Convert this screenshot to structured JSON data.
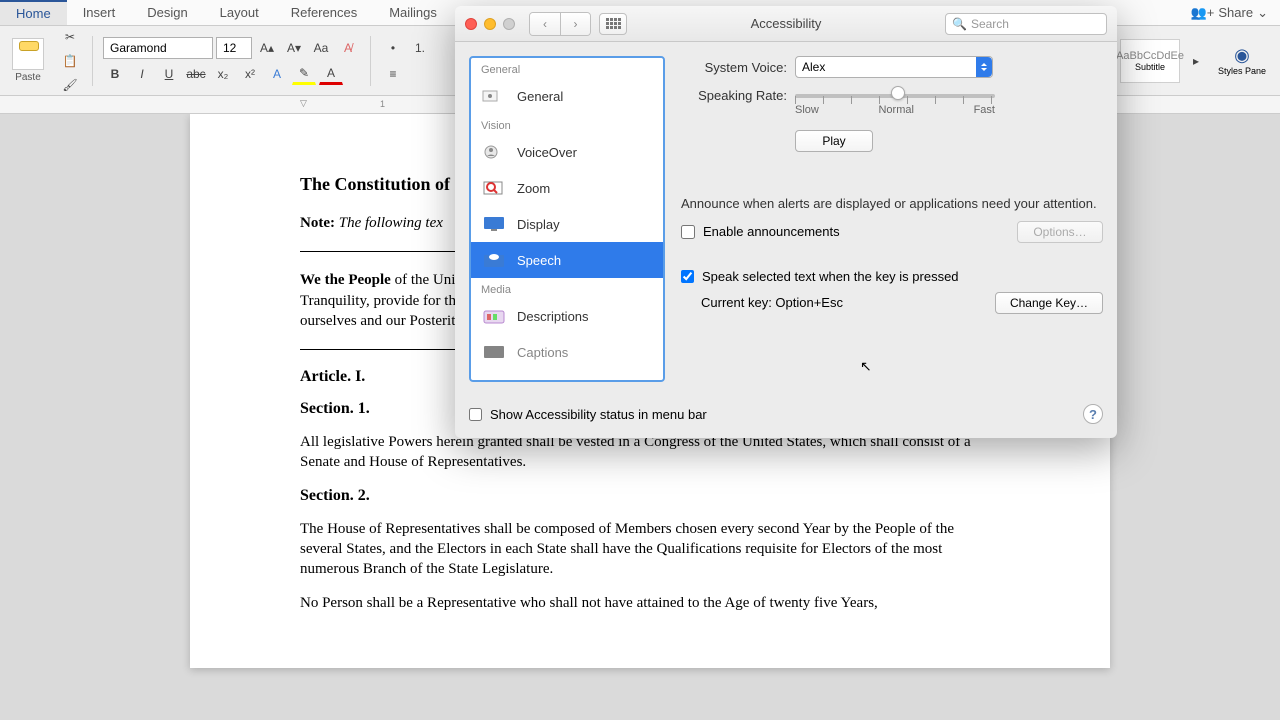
{
  "ribbon": {
    "tabs": [
      "Home",
      "Insert",
      "Design",
      "Layout",
      "References",
      "Mailings"
    ],
    "share": "Share"
  },
  "toolbar": {
    "paste": "Paste",
    "font": "Garamond",
    "size": "12"
  },
  "styles": {
    "preview_text": "AaBbCcDdEe",
    "subtitle": "Subtitle",
    "pane": "Styles Pane"
  },
  "document": {
    "title": "The Constitution of",
    "note_label": "Note:",
    "note_text": " The following tex",
    "preamble": "We the People of the United States, in Order to form a more perfect Union, establish Justice, insure domestic Tranquility, provide for the common defence, promote the general Welfare, and secure the Blessings of Liberty to ourselves and our Posterity, do ordain and establish this Constitution for the United States of America.",
    "article1": "Article. I.",
    "section1": "Section. 1.",
    "sec1_body": "All legislative Powers herein granted shall be vested in a Congress of the United States, which shall consist of a Senate and House of Representatives.",
    "section2": "Section. 2.",
    "sec2_body1": "The House of Representatives shall be composed of Members chosen every second Year by the People of the several States, and the Electors in each State shall have the Qualifications requisite for Electors of the most numerous Branch of the State Legislature.",
    "sec2_body2": "No Person shall be a Representative who shall not have attained to the Age of twenty five Years,"
  },
  "pref": {
    "title": "Accessibility",
    "search_placeholder": "Search",
    "sections": {
      "general": "General",
      "vision": "Vision",
      "media": "Media"
    },
    "items": {
      "general": "General",
      "voiceover": "VoiceOver",
      "zoom": "Zoom",
      "display": "Display",
      "speech": "Speech",
      "descriptions": "Descriptions",
      "captions": "Captions"
    },
    "detail": {
      "system_voice_label": "System Voice:",
      "system_voice_value": "Alex",
      "rate_label": "Speaking Rate:",
      "rate_slow": "Slow",
      "rate_normal": "Normal",
      "rate_fast": "Fast",
      "play": "Play",
      "announce_text": "Announce when alerts are displayed or applications need your attention.",
      "enable_announcements": "Enable announcements",
      "options": "Options…",
      "speak_selected": "Speak selected text when the key is pressed",
      "current_key": "Current key: Option+Esc",
      "change_key": "Change Key…"
    },
    "footer": {
      "show_status": "Show Accessibility status in menu bar"
    }
  }
}
